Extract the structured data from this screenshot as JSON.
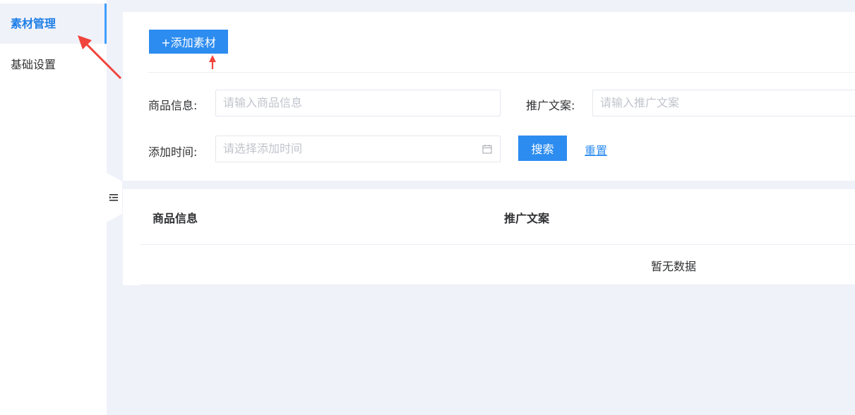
{
  "sidebar": {
    "items": [
      {
        "label": "素材管理",
        "active": true
      },
      {
        "label": "基础设置",
        "active": false
      }
    ]
  },
  "toolbar": {
    "add_label": "+添加素材"
  },
  "filters": {
    "product_label": "商品信息:",
    "product_placeholder": "请输入商品信息",
    "copy_label": "推广文案:",
    "copy_placeholder": "请输入推广文案",
    "time_label": "添加时间:",
    "time_placeholder": "请选择添加时间",
    "search_label": "搜索",
    "reset_label": "重置"
  },
  "table": {
    "columns": [
      "商品信息",
      "推广文案"
    ],
    "empty_text": "暂无数据"
  },
  "colors": {
    "accent": "#2d8cf0",
    "annotation_arrow": "#f0443c",
    "page_bg": "#f0f2fa"
  },
  "icons": [
    "collapse-menu-icon",
    "calendar-icon"
  ]
}
